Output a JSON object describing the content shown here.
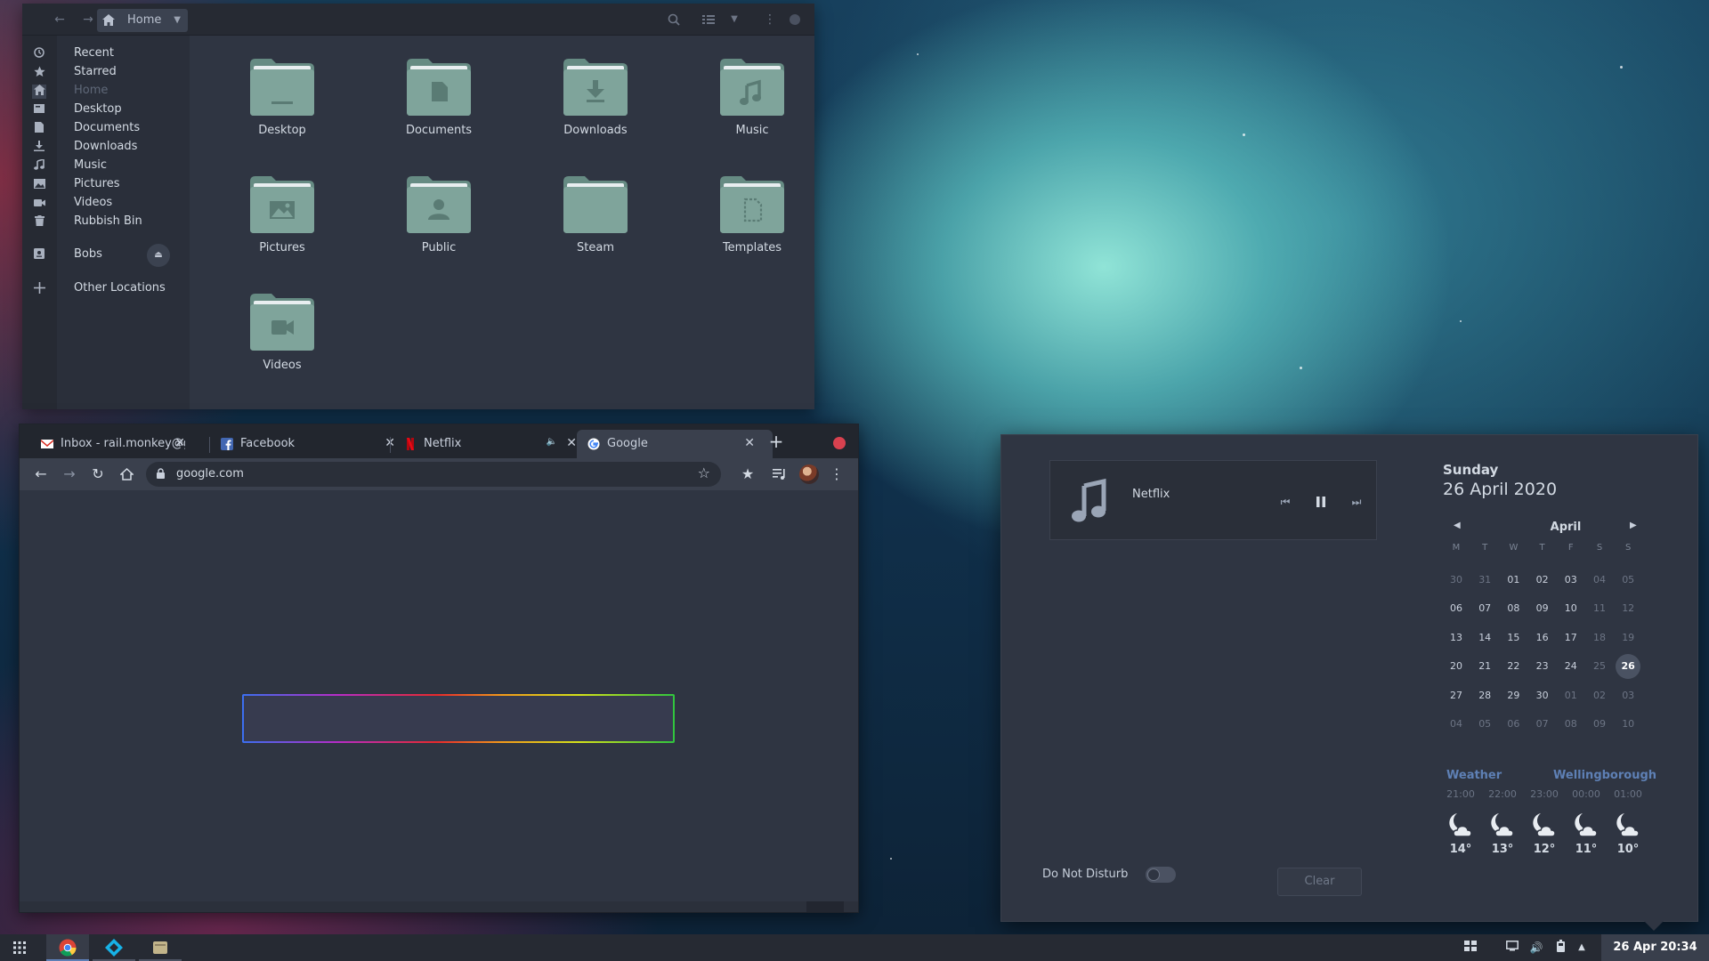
{
  "files": {
    "path_label": "Home",
    "sidebar": [
      {
        "label": "Recent",
        "icon": "clock-icon"
      },
      {
        "label": "Starred",
        "icon": "star-icon"
      },
      {
        "label": "Home",
        "icon": "home-icon",
        "active": true
      },
      {
        "label": "Desktop",
        "icon": "desktop-icon"
      },
      {
        "label": "Documents",
        "icon": "document-icon"
      },
      {
        "label": "Downloads",
        "icon": "download-icon"
      },
      {
        "label": "Music",
        "icon": "music-icon"
      },
      {
        "label": "Pictures",
        "icon": "picture-icon"
      },
      {
        "label": "Videos",
        "icon": "video-icon"
      },
      {
        "label": "Rubbish Bin",
        "icon": "trash-icon"
      },
      {
        "label": "Bobs",
        "icon": "drive-icon"
      },
      {
        "label": "Other Locations",
        "icon": "plus-icon"
      }
    ],
    "folders": [
      {
        "name": "Desktop",
        "glyph": "desktop"
      },
      {
        "name": "Documents",
        "glyph": "document"
      },
      {
        "name": "Downloads",
        "glyph": "download"
      },
      {
        "name": "Music",
        "glyph": "music"
      },
      {
        "name": "Pictures",
        "glyph": "picture"
      },
      {
        "name": "Public",
        "glyph": "person"
      },
      {
        "name": "Steam",
        "glyph": "none"
      },
      {
        "name": "Templates",
        "glyph": "template"
      },
      {
        "name": "Videos",
        "glyph": "video"
      }
    ]
  },
  "browser": {
    "tabs": [
      {
        "title": "Inbox - rail.monkey@gmail.com",
        "favicon": "gmail-icon"
      },
      {
        "title": "Facebook",
        "favicon": "facebook-icon"
      },
      {
        "title": "Netflix",
        "favicon": "netflix-icon",
        "muted": true
      },
      {
        "title": "Google",
        "favicon": "google-icon",
        "active": true
      }
    ],
    "url": "google.com"
  },
  "popover": {
    "media": {
      "title": "Netflix"
    },
    "dnd_label": "Do Not Disturb",
    "clear_label": "Clear",
    "day_name": "Sunday",
    "full_date": "26 April 2020",
    "month": "April",
    "weekday_headers": [
      "M",
      "T",
      "W",
      "T",
      "F",
      "S",
      "S"
    ],
    "calendar_rows": [
      [
        "30",
        "31",
        "01",
        "02",
        "03",
        "04",
        "05"
      ],
      [
        "06",
        "07",
        "08",
        "09",
        "10",
        "11",
        "12"
      ],
      [
        "13",
        "14",
        "15",
        "16",
        "17",
        "18",
        "19"
      ],
      [
        "20",
        "21",
        "22",
        "23",
        "24",
        "25",
        "26"
      ],
      [
        "27",
        "28",
        "29",
        "30",
        "01",
        "02",
        "03"
      ],
      [
        "04",
        "05",
        "06",
        "07",
        "08",
        "09",
        "10"
      ]
    ],
    "today": "26",
    "weather_label": "Weather",
    "location": "Wellingborough",
    "forecast": [
      {
        "time": "21:00",
        "temp": "14°"
      },
      {
        "time": "22:00",
        "temp": "13°"
      },
      {
        "time": "23:00",
        "temp": "12°"
      },
      {
        "time": "00:00",
        "temp": "11°"
      },
      {
        "time": "01:00",
        "temp": "10°"
      }
    ]
  },
  "taskbar": {
    "clock": "26 Apr  20:34"
  },
  "colors": {
    "accent": "#5d7fb6",
    "folder": "#7fa49b",
    "window_bg": "#2f3542",
    "close_red": "#d8414f"
  }
}
